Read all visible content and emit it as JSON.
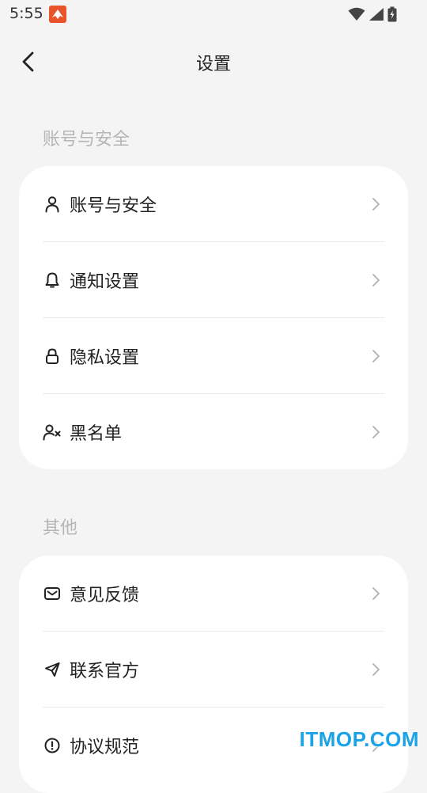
{
  "status_bar": {
    "time": "5:55"
  },
  "header": {
    "title": "设置"
  },
  "sections": [
    {
      "label": "账号与安全",
      "items": [
        {
          "label": "账号与安全",
          "icon": "user-icon"
        },
        {
          "label": "通知设置",
          "icon": "bell-icon"
        },
        {
          "label": "隐私设置",
          "icon": "lock-icon"
        },
        {
          "label": "黑名单",
          "icon": "user-block-icon"
        }
      ]
    },
    {
      "label": "其他",
      "items": [
        {
          "label": "意见反馈",
          "icon": "mail-icon"
        },
        {
          "label": "联系官方",
          "icon": "send-icon"
        },
        {
          "label": "协议规范",
          "icon": "info-circle-icon"
        }
      ]
    }
  ],
  "watermark": "ITMOP.COM",
  "colors": {
    "background": "#f4f4f4",
    "card": "#ffffff",
    "section_label": "#b5b5b5",
    "text": "#222222",
    "chevron": "#b0b0b0",
    "watermark": "#1aa3e6"
  }
}
